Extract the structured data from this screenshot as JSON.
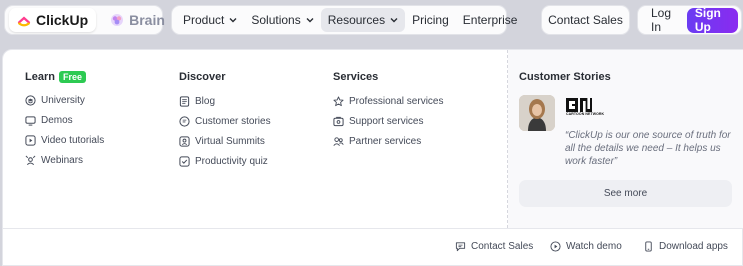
{
  "header": {
    "brand": "ClickUp",
    "brain": "Brain",
    "nav": [
      {
        "label": "Product",
        "has_menu": true
      },
      {
        "label": "Solutions",
        "has_menu": true
      },
      {
        "label": "Resources",
        "has_menu": true,
        "active": true
      },
      {
        "label": "Pricing",
        "has_menu": false
      },
      {
        "label": "Enterprise",
        "has_menu": false
      }
    ],
    "contact_sales": "Contact Sales",
    "login": "Log In",
    "signup": "Sign Up"
  },
  "menu": {
    "learn": {
      "title": "Learn",
      "badge": "Free",
      "items": [
        {
          "label": "University",
          "icon": "graduation-icon"
        },
        {
          "label": "Demos",
          "icon": "monitor-icon"
        },
        {
          "label": "Video tutorials",
          "icon": "play-icon"
        },
        {
          "label": "Webinars",
          "icon": "webinar-icon"
        }
      ]
    },
    "discover": {
      "title": "Discover",
      "items": [
        {
          "label": "Blog",
          "icon": "document-icon"
        },
        {
          "label": "Customer stories",
          "icon": "story-icon"
        },
        {
          "label": "Virtual Summits",
          "icon": "summit-icon"
        },
        {
          "label": "Productivity quiz",
          "icon": "checkbox-icon"
        }
      ]
    },
    "services": {
      "title": "Services",
      "items": [
        {
          "label": "Professional services",
          "icon": "star-icon"
        },
        {
          "label": "Support services",
          "icon": "support-icon"
        },
        {
          "label": "Partner services",
          "icon": "partners-icon"
        }
      ]
    },
    "customer_stories": {
      "title": "Customer Stories",
      "quote": "“ClickUp is our one source of truth for all the details we need – It helps us work faster”",
      "logo_text": "CN",
      "logo_caption": "CARTOON NETWORK",
      "see_more": "See more"
    },
    "footer": [
      {
        "label": "Contact Sales",
        "icon": "chat-icon"
      },
      {
        "label": "Watch demo",
        "icon": "play-circle-icon"
      },
      {
        "label": "Download apps",
        "icon": "phone-icon"
      }
    ]
  },
  "colors": {
    "accent": "#7b3ff2",
    "free_badge": "#2dca52",
    "background": "#d3d4dc"
  }
}
